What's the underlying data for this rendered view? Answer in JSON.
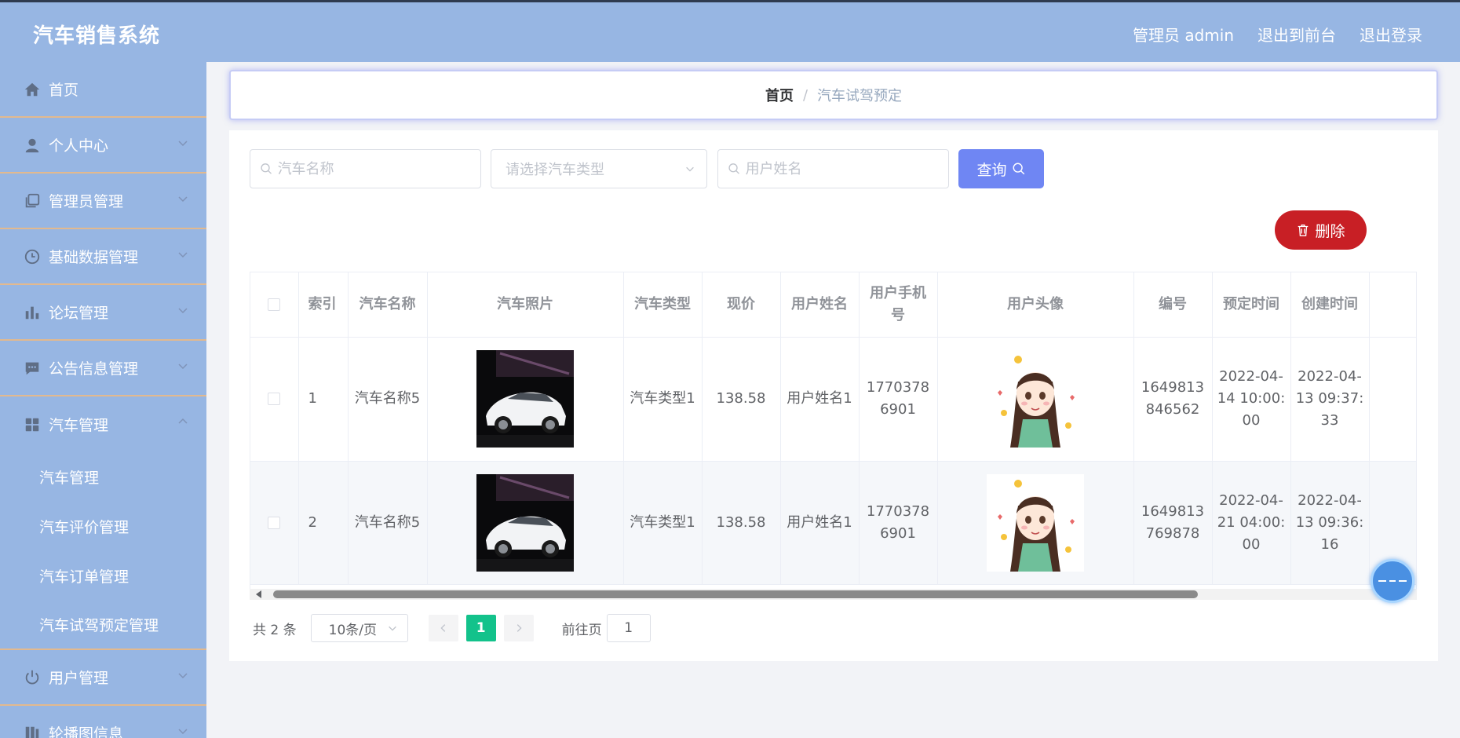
{
  "header": {
    "app_title": "汽车销售系统",
    "admin_label": "管理员 admin",
    "front_link": "退出到前台",
    "logout_link": "退出登录"
  },
  "sidebar": {
    "items": [
      {
        "label": "首页",
        "icon": "home-icon"
      },
      {
        "label": "个人中心",
        "icon": "user-icon"
      },
      {
        "label": "管理员管理",
        "icon": "copy-icon"
      },
      {
        "label": "基础数据管理",
        "icon": "clock-icon"
      },
      {
        "label": "论坛管理",
        "icon": "bar-chart-icon"
      },
      {
        "label": "公告信息管理",
        "icon": "chat-icon"
      },
      {
        "label": "汽车管理",
        "icon": "grid-icon"
      }
    ],
    "sub_items": [
      "汽车管理",
      "汽车评价管理",
      "汽车订单管理",
      "汽车试驾预定管理"
    ],
    "after_items": [
      {
        "label": "用户管理",
        "icon": "power-icon"
      },
      {
        "label": "轮播图信息",
        "icon": "bookmark-icon"
      }
    ]
  },
  "breadcrumb": {
    "home": "首页",
    "separator": "/",
    "current": "汽车试驾预定"
  },
  "search": {
    "car_name_placeholder": "汽车名称",
    "car_type_placeholder": "请选择汽车类型",
    "user_name_placeholder": "用户姓名",
    "query_label": "查询"
  },
  "actions": {
    "delete_label": "删除"
  },
  "table": {
    "headers": [
      "",
      "索引",
      "汽车名称",
      "汽车照片",
      "汽车类型",
      "现价",
      "用户姓名",
      "用户手机号",
      "用户头像",
      "编号",
      "预定时间",
      "创建时间",
      ""
    ],
    "rows": [
      {
        "index": "1",
        "car_name": "汽车名称5",
        "car_type": "汽车类型1",
        "price": "138.58",
        "user_name": "用户姓名1",
        "phone": "17703786901",
        "number": "1649813846562",
        "booking_time": "2022-04-14 10:00:00",
        "created_time": "2022-04-13 09:37:33"
      },
      {
        "index": "2",
        "car_name": "汽车名称5",
        "car_type": "汽车类型1",
        "price": "138.58",
        "user_name": "用户姓名1",
        "phone": "17703786901",
        "number": "1649813769878",
        "booking_time": "2022-04-21 04:00:00",
        "created_time": "2022-04-13 09:36:16"
      }
    ]
  },
  "pagination": {
    "total": "共 2 条",
    "page_size": "10条/页",
    "current_page": "1",
    "goto_label": "前往页",
    "goto_value": "1"
  },
  "colors": {
    "header_bg": "#97b6e3",
    "primary_button": "#6f86f3",
    "delete_button": "#c81f25",
    "active_page": "#13c28b"
  }
}
